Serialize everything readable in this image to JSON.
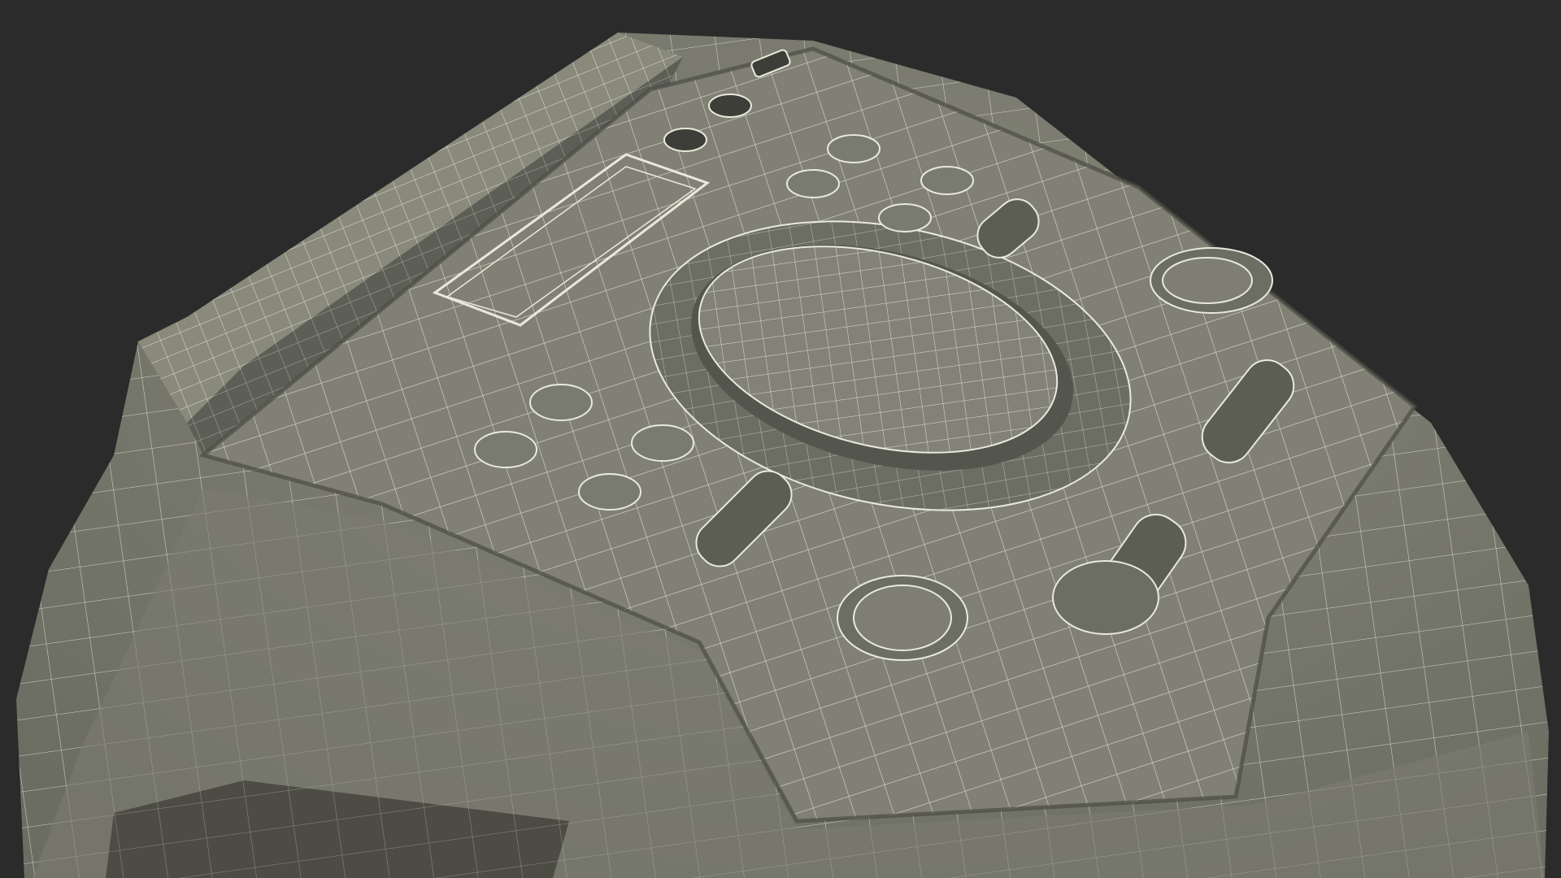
{
  "scene": {
    "background_color": "#2b2b2b",
    "surface_color": "#7e7f72",
    "surface_dark_color": "#5f6056",
    "wire_color": "#e9e9dd",
    "recess_color": "#4c4c44",
    "subject": "wireframe-speaker-top"
  }
}
